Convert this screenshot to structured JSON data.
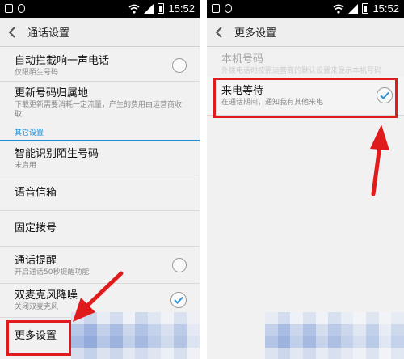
{
  "status_bar": {
    "time": "15:52"
  },
  "left_screen": {
    "title": "通话设置",
    "items": [
      {
        "label": "自动拦截响一声电话",
        "sub": "仅限陌生号码",
        "control": "radio"
      },
      {
        "label": "更新号码归属地",
        "sub": "下载更新需要消耗一定流量，产生的费用由运营商收取",
        "control": "none"
      },
      {
        "label": "智能识别陌生号码",
        "sub": "未启用",
        "control": "none"
      },
      {
        "label": "语音信箱",
        "sub": "",
        "control": "none"
      },
      {
        "label": "固定拨号",
        "sub": "",
        "control": "none"
      },
      {
        "label": "通话提醒",
        "sub": "开启通话50秒提醒功能",
        "control": "radio"
      },
      {
        "label": "双麦克风降噪",
        "sub": "关闭双麦克风",
        "control": "check"
      },
      {
        "label": "更多设置",
        "sub": "",
        "control": "none"
      }
    ],
    "section_header": "其它设置"
  },
  "right_screen": {
    "title": "更多设置",
    "faded_item": {
      "label": "本机号码",
      "sub": "外拨电话时按照运营商的默认设置来显示本机号码"
    },
    "highlight_item": {
      "label": "来电等待",
      "sub": "在通话期间，通知我有其他来电"
    }
  },
  "colors": {
    "accent": "#1c8fd8",
    "highlight": "#e01b1b",
    "checkmark": "#2b8fd6"
  },
  "icons": [
    "back-arrow-icon",
    "wifi-icon",
    "signal-icon",
    "battery-icon",
    "checkmark-icon",
    "annotation-arrow"
  ]
}
